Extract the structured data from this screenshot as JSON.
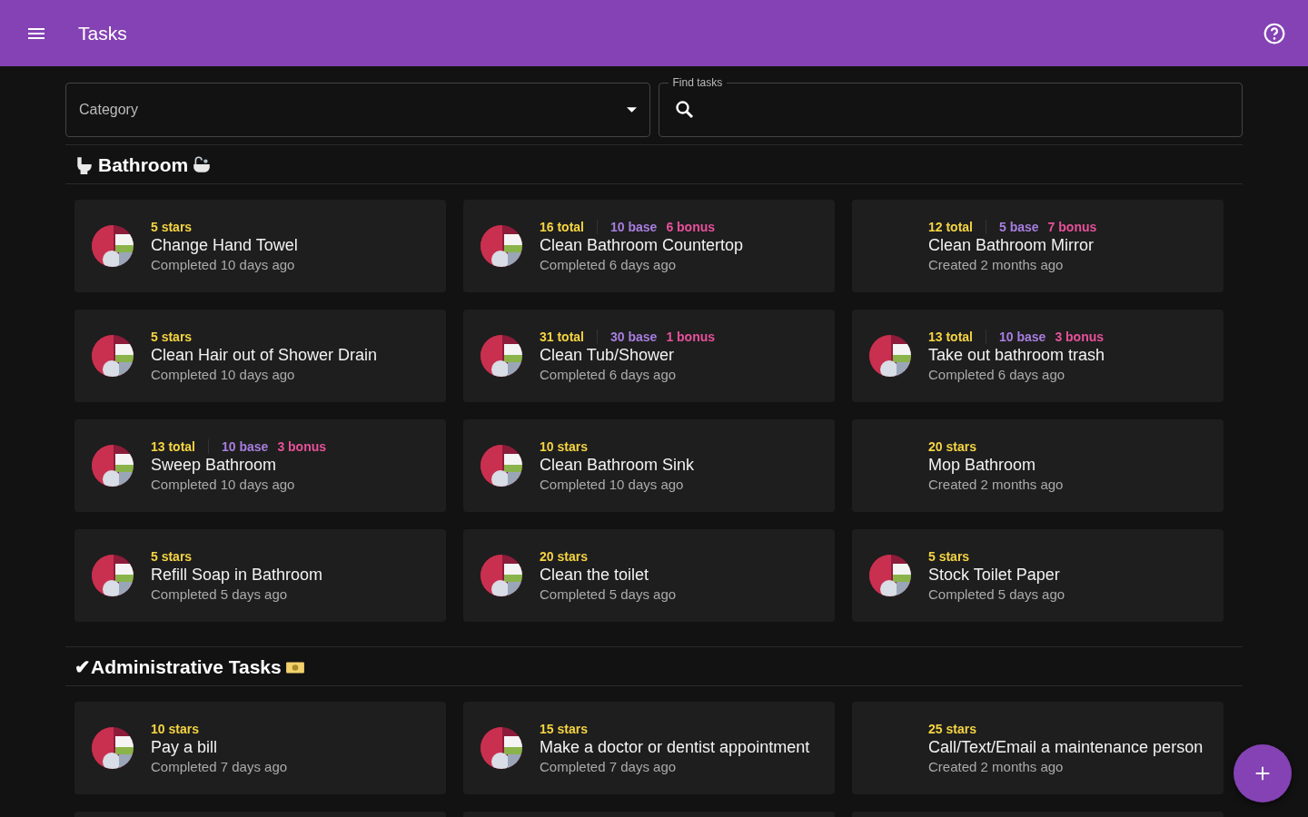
{
  "app_bar": {
    "title": "Tasks"
  },
  "filters": {
    "category": {
      "placeholder": "Category"
    },
    "search": {
      "label": "Find tasks"
    }
  },
  "sections": [
    {
      "title": "Bathroom",
      "tasks": [
        {
          "points": {
            "kind": "stars",
            "stars_text": "5 stars"
          },
          "name": "Change Hand Towel",
          "status": "Completed 10 days ago",
          "has_avatar": true
        },
        {
          "points": {
            "kind": "split",
            "total": "16 total",
            "base": "10 base",
            "bonus": "6 bonus"
          },
          "name": "Clean Bathroom Countertop",
          "status": "Completed 6 days ago",
          "has_avatar": true
        },
        {
          "points": {
            "kind": "split",
            "total": "12 total",
            "base": "5 base",
            "bonus": "7 bonus"
          },
          "name": "Clean Bathroom Mirror",
          "status": "Created 2 months ago",
          "has_avatar": false
        },
        {
          "points": {
            "kind": "stars",
            "stars_text": "5 stars"
          },
          "name": "Clean Hair out of Shower Drain",
          "status": "Completed 10 days ago",
          "has_avatar": true
        },
        {
          "points": {
            "kind": "split",
            "total": "31 total",
            "base": "30 base",
            "bonus": "1 bonus"
          },
          "name": "Clean Tub/Shower",
          "status": "Completed 6 days ago",
          "has_avatar": true
        },
        {
          "points": {
            "kind": "split",
            "total": "13 total",
            "base": "10 base",
            "bonus": "3 bonus"
          },
          "name": "Take out bathroom trash",
          "status": "Completed 6 days ago",
          "has_avatar": true
        },
        {
          "points": {
            "kind": "split",
            "total": "13 total",
            "base": "10 base",
            "bonus": "3 bonus"
          },
          "name": "Sweep Bathroom",
          "status": "Completed 10 days ago",
          "has_avatar": true
        },
        {
          "points": {
            "kind": "stars",
            "stars_text": "10 stars"
          },
          "name": "Clean Bathroom Sink",
          "status": "Completed 10 days ago",
          "has_avatar": true
        },
        {
          "points": {
            "kind": "stars",
            "stars_text": "20 stars"
          },
          "name": "Mop Bathroom",
          "status": "Created 2 months ago",
          "has_avatar": false
        },
        {
          "points": {
            "kind": "stars",
            "stars_text": "5 stars"
          },
          "name": "Refill Soap in Bathroom",
          "status": "Completed 5 days ago",
          "has_avatar": true
        },
        {
          "points": {
            "kind": "stars",
            "stars_text": "20 stars"
          },
          "name": "Clean the toilet",
          "status": "Completed 5 days ago",
          "has_avatar": true
        },
        {
          "points": {
            "kind": "stars",
            "stars_text": "5 stars"
          },
          "name": "Stock Toilet Paper",
          "status": "Completed 5 days ago",
          "has_avatar": true
        }
      ]
    },
    {
      "title": "✔Administrative Tasks",
      "tasks": [
        {
          "points": {
            "kind": "stars",
            "stars_text": "10 stars"
          },
          "name": "Pay a bill",
          "status": "Completed 7 days ago",
          "has_avatar": true
        },
        {
          "points": {
            "kind": "stars",
            "stars_text": "15 stars"
          },
          "name": "Make a doctor or dentist appointment",
          "status": "Completed 7 days ago",
          "has_avatar": true
        },
        {
          "points": {
            "kind": "stars",
            "stars_text": "25 stars"
          },
          "name": "Call/Text/Email a maintenance person",
          "status": "Created 2 months ago",
          "has_avatar": false
        },
        {
          "kind": "cut"
        },
        {
          "kind": "cut"
        },
        {
          "kind": "cut"
        }
      ]
    }
  ]
}
